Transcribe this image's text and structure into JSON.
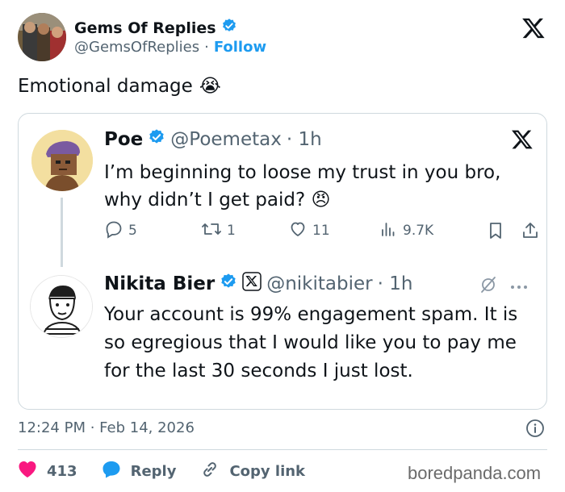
{
  "author": {
    "name": "Gems Of Replies",
    "handle": "@GemsOfReplies",
    "separator": "·",
    "follow_label": "Follow",
    "verified_color": "#1d9bf0"
  },
  "tweet": {
    "text": "Emotional damage",
    "emoji": "😭"
  },
  "embedded": {
    "poe": {
      "name": "Poe",
      "handle": "@Poemetax",
      "time": "· 1h",
      "text": "I’m beginning to loose my trust in you bro, why didn’t I get paid?",
      "emoji": "😠"
    },
    "actions": {
      "replies": "5",
      "retweets": "1",
      "likes": "11",
      "views": "9.7K"
    },
    "nikita": {
      "name": "Nikita Bier",
      "handle": "@nikitabier",
      "time": "· 1h",
      "text": "Your account is 99% engagement spam. It is so egregious that I would like you to pay me for the last 30 seconds I just lost."
    }
  },
  "footer": {
    "timestamp": "12:24 PM · Feb 14, 2026",
    "likes_count": "413",
    "reply_label": "Reply",
    "copy_label": "Copy link",
    "watermark": "boredpanda.com",
    "like_color": "#f91880",
    "reply_color": "#1d9bf0"
  }
}
